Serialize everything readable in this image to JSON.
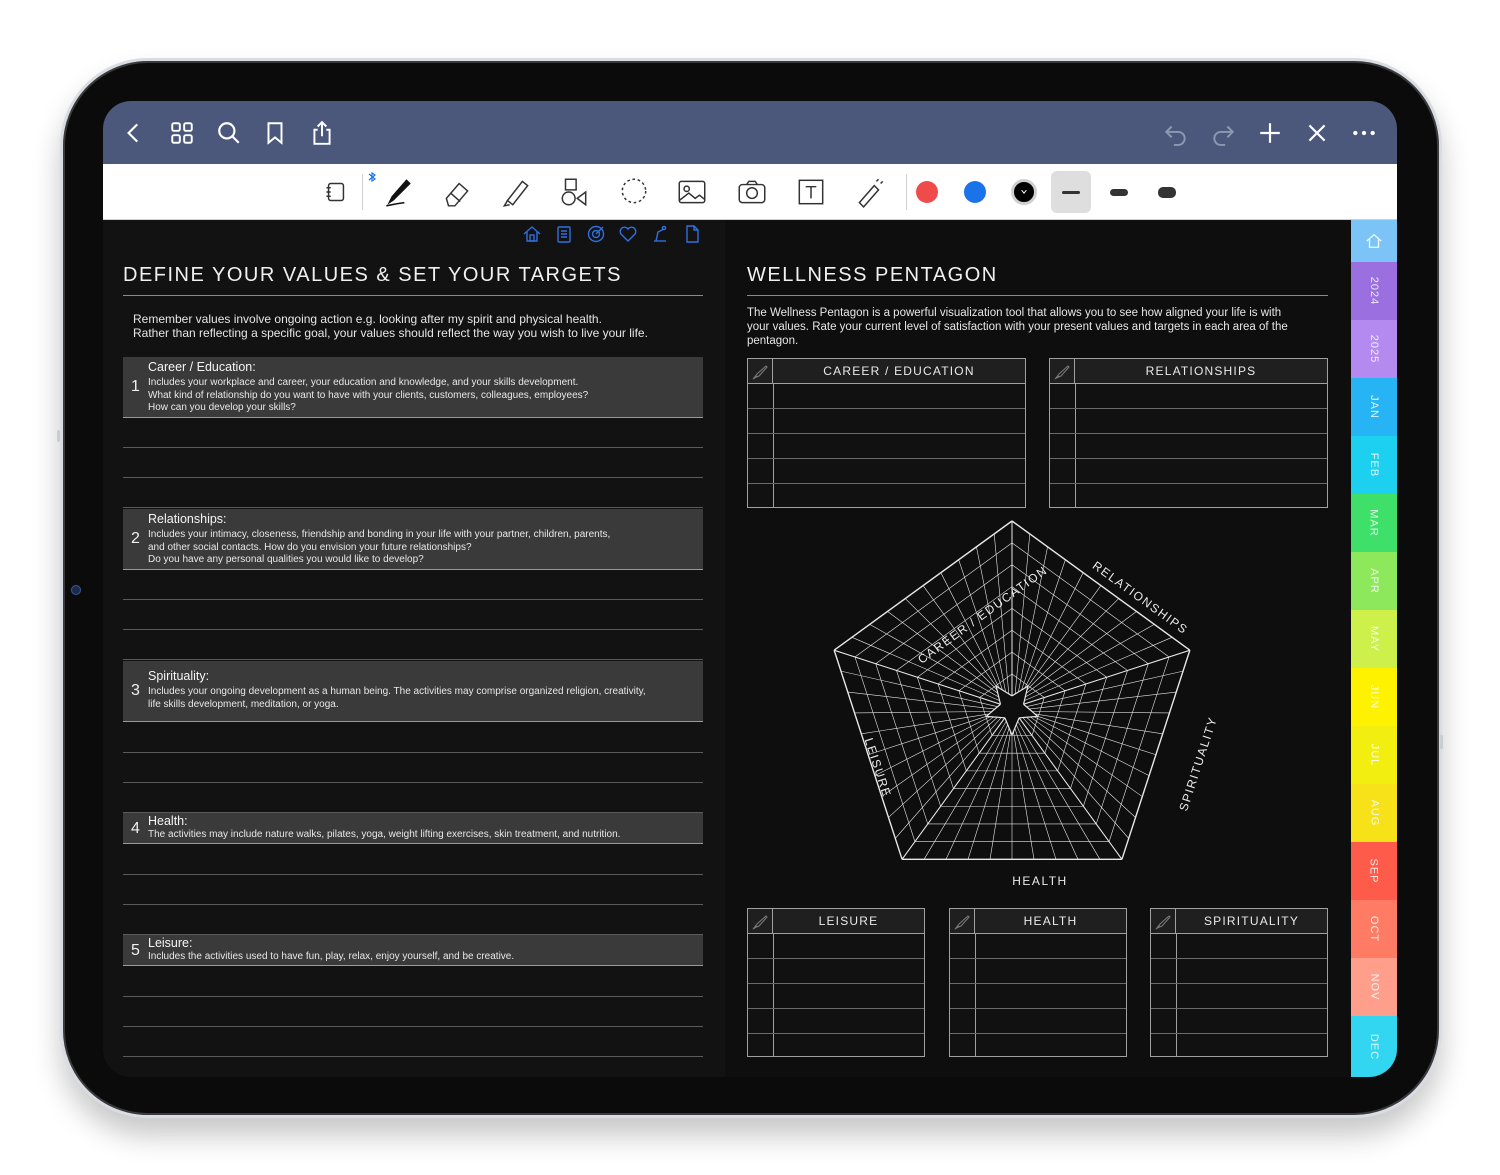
{
  "toolbar_colors": {
    "red": "#ef4b4b",
    "blue": "#1a73e8",
    "black": "#000000",
    "accent": "#4b587c"
  },
  "left_page": {
    "title": "DEFINE YOUR VALUES & SET YOUR TARGETS",
    "intro": [
      "Remember values involve ongoing action e.g. looking after my spirit and physical health.",
      "Rather than reflecting a specific goal, your values should reflect the way you wish to live your life."
    ],
    "categories": [
      {
        "num": "1",
        "title": "Career / Education:",
        "desc": [
          "Includes your workplace and career, your education and knowledge, and your skills development.",
          "What kind of relationship do you want to have with your clients, customers, colleagues, employees?",
          "How can you develop your skills?"
        ]
      },
      {
        "num": "2",
        "title": "Relationships:",
        "desc": [
          "Includes your intimacy, closeness, friendship and bonding in your life with your partner, children, parents,",
          "and other social contacts. How do you envision your future relationships?",
          "Do you have any personal qualities you would like to develop?"
        ]
      },
      {
        "num": "3",
        "title": "Spirituality:",
        "desc": [
          "Includes your ongoing development as a human being. The activities may comprise organized religion, creativity,",
          "life skills development, meditation, or yoga."
        ]
      },
      {
        "num": "4",
        "title": "Health:",
        "desc": [
          "The activities may include nature walks, pilates, yoga, weight lifting exercises, skin treatment, and nutrition."
        ]
      },
      {
        "num": "5",
        "title": "Leisure:",
        "desc": [
          "Includes the activities used to have fun, play, relax, enjoy yourself, and be creative."
        ]
      }
    ]
  },
  "right_page": {
    "title": "WELLNESS PENTAGON",
    "intro": [
      "The Wellness Pentagon is a powerful visualization tool that allows you to see how aligned your life is with",
      "your values. Rate your current level of satisfaction with your present values and targets in each area of the",
      "pentagon."
    ],
    "tables": {
      "career": "CAREER / EDUCATION",
      "relationships": "RELATIONSHIPS",
      "leisure": "LEISURE",
      "health": "HEALTH",
      "spirituality": "SPIRITUALITY"
    },
    "pentagon_axes": {
      "career": "CAREER / EDUCATION",
      "relationships": "RELATIONSHIPS",
      "spirituality": "SPIRITUALITY",
      "health": "HEALTH",
      "leisure": "LEISURE"
    }
  },
  "tabs": [
    {
      "label": "",
      "icon": "home-icon",
      "color": "#7cc4f7"
    },
    {
      "label": "2024",
      "color": "#9b6fe0"
    },
    {
      "label": "2025",
      "color": "#b58af0"
    },
    {
      "label": "JAN",
      "color": "#27b4f5"
    },
    {
      "label": "FEB",
      "color": "#1ed0ef"
    },
    {
      "label": "MAR",
      "color": "#3ee06a"
    },
    {
      "label": "APR",
      "color": "#8ee85c"
    },
    {
      "label": "MAY",
      "color": "#cdf04b"
    },
    {
      "label": "JUN",
      "color": "#fff200"
    },
    {
      "label": "JUL",
      "color": "#f2ee10"
    },
    {
      "label": "AUG",
      "color": "#f7e21a"
    },
    {
      "label": "SEP",
      "color": "#ff5b4a"
    },
    {
      "label": "OCT",
      "color": "#ff7b63"
    },
    {
      "label": "NOV",
      "color": "#ff9e8a"
    },
    {
      "label": "DEC",
      "color": "#33d6f0"
    }
  ]
}
